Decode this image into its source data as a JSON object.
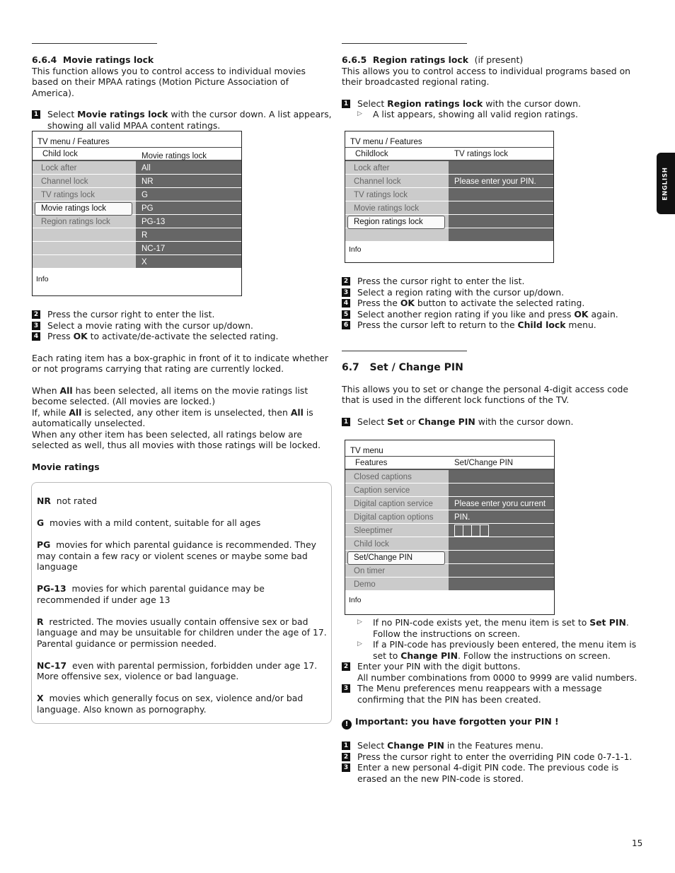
{
  "page_number": "15",
  "language_tab": "ENGLISH",
  "left": {
    "section_664": {
      "number": "6.6.4",
      "title": "Movie ratings lock",
      "intro": "This function allows you to control access to individual movies based on their MPAA ratings (Motion Picture Association of America).",
      "step1": {
        "num": "1",
        "pre": "Select ",
        "bold": "Movie ratings lock",
        "post": " with the cursor down. A list appears, showing all valid MPAA content ratings."
      },
      "menu": {
        "title": "TV menu / Features",
        "header_left": "Child lock",
        "header_right": "Movie ratings lock",
        "left_items": [
          "Lock after",
          "Channel lock",
          "TV ratings lock",
          "Movie ratings lock",
          "Region ratings lock",
          "",
          "",
          ""
        ],
        "selected_index": 3,
        "right_items": [
          "All",
          "NR",
          "G",
          "PG",
          "PG-13",
          "R",
          "NC-17",
          "X"
        ],
        "info": "Info"
      },
      "step2": {
        "num": "2",
        "text": "Press the cursor right to enter the list."
      },
      "step3": {
        "num": "3",
        "text": "Select a movie rating with the cursor up/down."
      },
      "step4": {
        "num": "4",
        "pre": "Press ",
        "bold": "OK",
        "post": " to activate/de-activate the selected rating."
      },
      "para_box": "Each rating item has a box-graphic in front of it to indicate whether or not programs carrying that rating are currently locked.",
      "para_all_1_pre": "When ",
      "para_all_1_bold": "All",
      "para_all_1_post": " has been selected, all items on the movie ratings list become selected. (All movies are locked.)",
      "para_all_2_pre": "If, while ",
      "para_all_2_bold": "All",
      "para_all_2_mid": " is selected, any other item is unselected, then ",
      "para_all_2_bold2": "All",
      "para_all_2_post": " is automatically unselected.",
      "para_all_3": "When any other item has been selected, all ratings below are selected as well, thus all movies with those ratings will be locked.",
      "ratings_heading": "Movie ratings",
      "ratings": [
        {
          "code": "NR",
          "desc": "not rated"
        },
        {
          "code": "G",
          "desc": "movies with a mild content, suitable for all ages"
        },
        {
          "code": "PG",
          "desc": "movies for which parental guidance is recommended. They may contain a few racy or violent scenes or maybe some bad language"
        },
        {
          "code": "PG-13",
          "desc": "movies for which parental guidance may be recommended if under age 13"
        },
        {
          "code": "R",
          "desc": "restricted. The movies usually contain offensive sex or bad language and may be unsuitable for children under the age of 17. Parental guidance or permission needed."
        },
        {
          "code": "NC-17",
          "desc": "even with parental permission, forbidden under age 17. More offensive sex, violence or bad language."
        },
        {
          "code": "X",
          "desc": "movies which generally focus on sex, violence and/or bad language. Also known as pornography."
        }
      ]
    }
  },
  "right": {
    "section_665": {
      "number": "6.6.5",
      "title": "Region ratings lock",
      "qualifier": "(if present)",
      "intro": "This allows you to control access to individual programs based on their broadcasted regional rating.",
      "step1": {
        "num": "1",
        "pre": "Select ",
        "bold": "Region ratings lock",
        "post": " with the cursor down."
      },
      "step1_sub": "A list appears, showing all valid region ratings.",
      "menu": {
        "title": "TV menu / Features",
        "header_left": "Childlock",
        "header_right": "TV ratings lock",
        "left_items": [
          "Lock after",
          "Channel lock",
          "TV ratings lock",
          "Movie ratings lock",
          "Region ratings lock",
          ""
        ],
        "selected_index": 4,
        "right_items": [
          "",
          "Please enter your PIN.",
          "",
          "",
          "",
          ""
        ],
        "info": "Info"
      },
      "step2": {
        "num": "2",
        "text": "Press the cursor right to enter the list."
      },
      "step3": {
        "num": "3",
        "text": "Select a region rating with the cursor up/down."
      },
      "step4": {
        "num": "4",
        "pre": "Press the ",
        "bold": "OK",
        "post": " button to activate the selected rating."
      },
      "step5": {
        "num": "5",
        "pre": "Select another region rating if you like and press ",
        "bold": "OK",
        "post": " again."
      },
      "step6": {
        "num": "6",
        "pre": "Press the cursor left to return to the ",
        "bold": "Child lock",
        "post": " menu."
      }
    },
    "section_67": {
      "number": "6.7",
      "title": "Set / Change PIN",
      "intro": "This allows you to set or change the personal 4-digit access code that is used in the different lock functions of the TV.",
      "step1": {
        "num": "1",
        "pre": "Select ",
        "bold": "Set",
        "mid": " or ",
        "bold2": "Change PIN",
        "post": " with the cursor down."
      },
      "menu": {
        "title": "TV menu",
        "header_left": "Features",
        "header_right": "Set/Change PIN",
        "left_items": [
          "Closed captions",
          "Caption service",
          "Digital caption service",
          "Digital caption options",
          "Sleeptimer",
          "Child lock",
          "Set/Change PIN",
          "On timer",
          "Demo"
        ],
        "selected_index": 6,
        "right_items": [
          "",
          "",
          "Please enter yoru current",
          "PIN.",
          "[pin]",
          "",
          "",
          "",
          ""
        ],
        "pin_digits": 4,
        "info": "Info"
      },
      "sub1": {
        "pre": "If no PIN-code exists yet, the menu item is set to ",
        "bold": "Set PIN",
        "post": ". Follow the instructions on screen."
      },
      "sub2": {
        "pre": "If a PIN-code has previously been entered, the menu item is set to ",
        "bold": "Change PIN",
        "post": ". Follow the instructions on screen."
      },
      "step2": {
        "num": "2",
        "text": "Enter your PIN with the digit buttons.",
        "text2": "All number combinations from 0000 to 9999 are valid numbers."
      },
      "step3": {
        "num": "3",
        "text": "The Menu preferences menu reappears with a message confirming that the PIN has been created."
      },
      "important": "Important: you have forgotten your PIN !",
      "forgot_steps": [
        {
          "num": "1",
          "pre": "Select ",
          "bold": "Change PIN",
          "post": " in the Features menu."
        },
        {
          "num": "2",
          "text": "Press the cursor right to enter the overriding PIN code 0-7-1-1."
        },
        {
          "num": "3",
          "text": "Enter a new personal 4-digit PIN code. The previous code is erased an the new PIN-code is stored."
        }
      ]
    }
  }
}
